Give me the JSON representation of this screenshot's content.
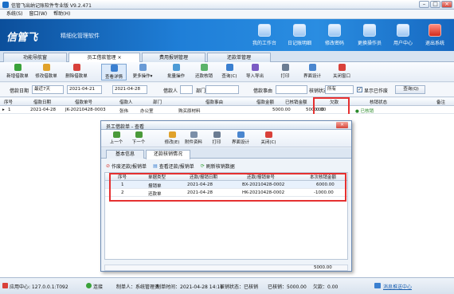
{
  "window": {
    "title": "信管飞出纳记账软件专业版 V9.2.471"
  },
  "menu": [
    "系统(S)",
    "窗口(W)",
    "帮助(H)"
  ],
  "banner": {
    "logo": "信管飞",
    "slogan": "精细化管理软件",
    "buttons": [
      "我的工作台",
      "日记账明细",
      "修改密码",
      "更换操作员",
      "用户中心",
      "退出系统"
    ]
  },
  "tabs": [
    "功能导航窗",
    "员工借款管理",
    "费用报销管理",
    "还款单管理"
  ],
  "toolbar": [
    "新增借款单",
    "修改借款单",
    "删除借款单",
    "查看详情",
    "更多操作",
    "批量操作",
    "还款核销",
    "查询(C)",
    "导入导出",
    "打印",
    "界面设计",
    "关闭窗口"
  ],
  "filter": {
    "date_label": "借款日期",
    "date_range": "最近7天",
    "date_from": "2021-04-21",
    "date_to": "2021-04-28",
    "borrower_label": "借款人",
    "dept_label": "部门",
    "reason_label": "借款事由",
    "status_label": "核销状态",
    "status_value": "所有",
    "show_voided": "显示已作废",
    "query_btn": "查询(Q)"
  },
  "grid": {
    "headers": [
      "序号",
      "借款日期",
      "借款单号",
      "借款人",
      "部门",
      "借款事由",
      "借款金额",
      "已核销金额",
      "欠款",
      "核销状态",
      "备注"
    ],
    "rows": [
      {
        "no": "1",
        "date": "2021-04-28",
        "bill": "JK-20210428-0003",
        "person": "张伟",
        "dept": "办公室",
        "reason": "购买原材料",
        "amount": "5000.00",
        "settled": "5000.00",
        "owed": "0.00",
        "status": "已核销"
      }
    ]
  },
  "status": {
    "app_center": "应用中心: 127.0.0.1:T092",
    "conn": "连接",
    "maker": "制单人：系统管理员",
    "make_time": "制单时间：2021-04-28 14:11",
    "status": "核销状态：已核销",
    "settled_amt": "已核销：5000.00",
    "owed_amt": "欠款：0.00",
    "msg": "消息推送中心"
  },
  "modal": {
    "title": "员工借款单 - 查看",
    "tools": [
      "上一个",
      "下一个",
      "修改(E)",
      "附件资料",
      "打印",
      "界面设计",
      "关闭(C)"
    ],
    "tabs": [
      "基本信息",
      "还款核销情况"
    ],
    "sub_tools": [
      "作废还款/报销单",
      "查看还款/报销单",
      "刷新核销数据"
    ],
    "headers": [
      "序号",
      "单据类型",
      "还款/报销日期",
      "还款/报销单号",
      "本次核销金额"
    ],
    "rows": [
      {
        "no": "1",
        "type": "报销单",
        "date": "2021-04-28",
        "bill": "BX-20210428-0002",
        "amount": "6000.00"
      },
      {
        "no": "2",
        "type": "还款单",
        "date": "2021-04-28",
        "bill": "HK-20210428-0002",
        "amount": "-1000.00"
      }
    ],
    "footer_total": "5000.00"
  }
}
